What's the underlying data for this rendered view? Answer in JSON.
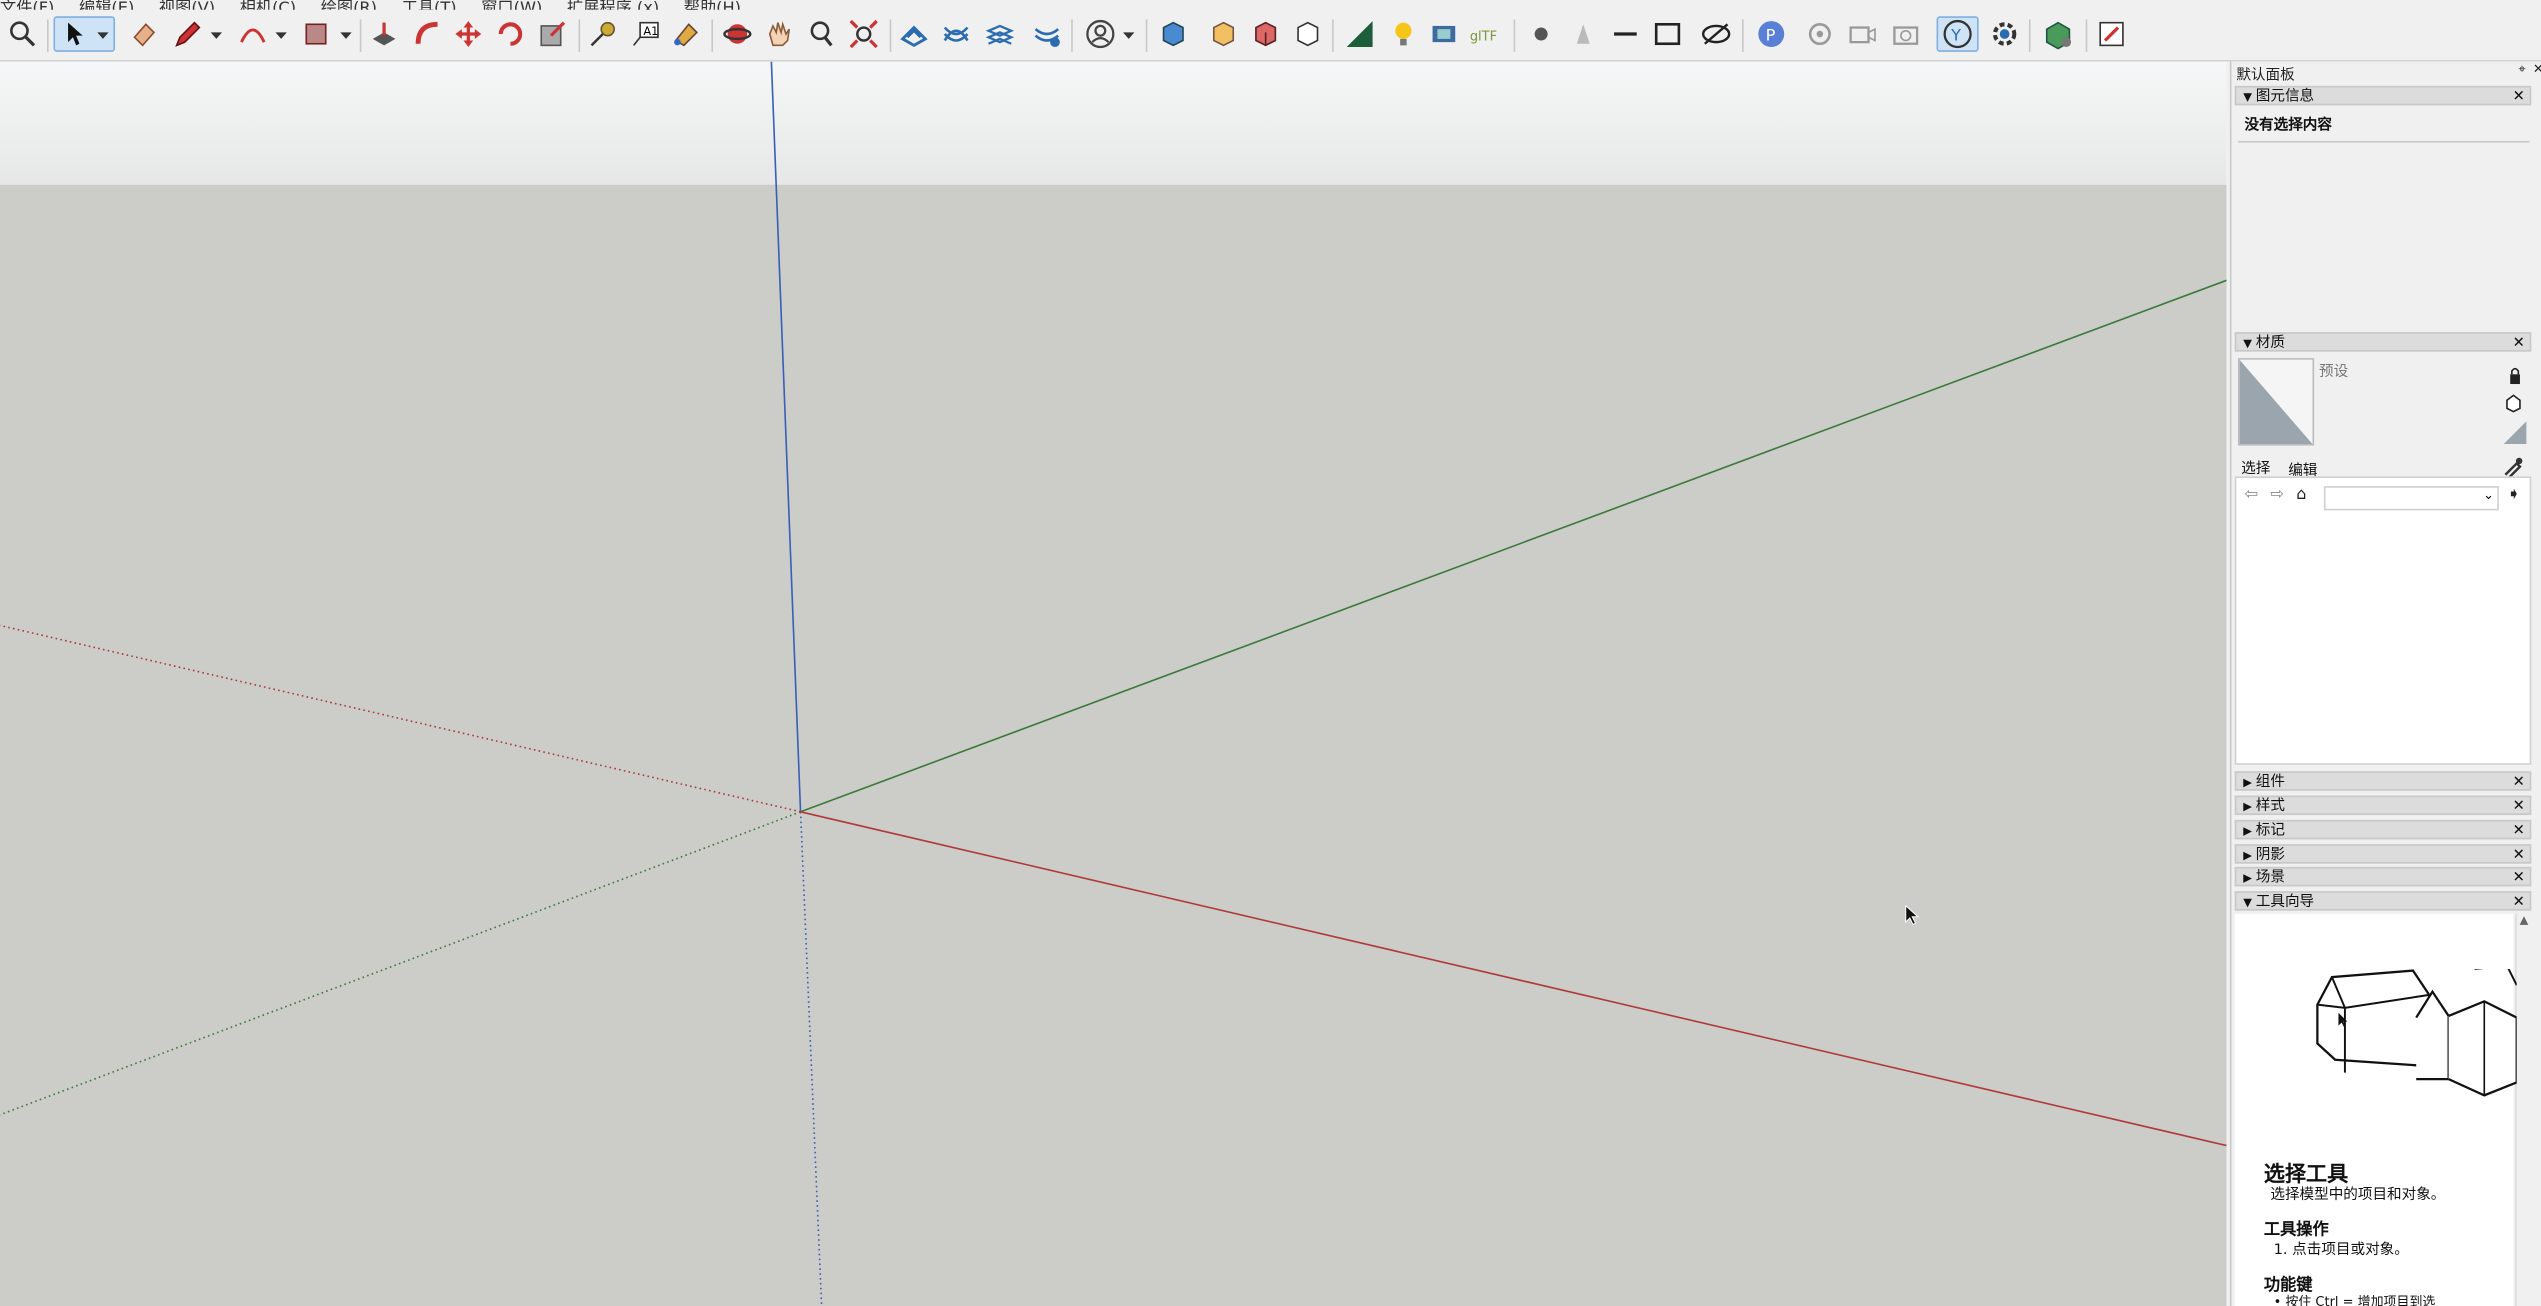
{
  "menu": [
    "文件(F)",
    "编辑(E)",
    "视图(V)",
    "相机(C)",
    "绘图(R)",
    "工具(T)",
    "窗口(W)",
    "扩展程序 (x)",
    "帮助(H)"
  ],
  "tray": {
    "title": "默认面板",
    "entity_info": {
      "label": "图元信息",
      "content": "没有选择内容"
    },
    "materials": {
      "label": "材质",
      "name_placeholder": "预设",
      "tab_select": "选择",
      "tab_edit": "编辑"
    },
    "collapsed": [
      "组件",
      "样式",
      "标记",
      "阴影",
      "场景"
    ],
    "instructor": {
      "label": "工具向导",
      "title": "选择工具",
      "subtitle": "选择模型中的项目和对象。",
      "ops_heading": "工具操作",
      "ops_step": "1. 点击项目或对象。",
      "keys_heading": "功能键",
      "keys_item": "• 按住 Ctrl = 增加项目到选"
    }
  },
  "colors": {
    "sky": "#f4f5f6",
    "ground": "#cccdc8",
    "red_axis": "#b03a3a",
    "green_axis": "#3c7a3c",
    "blue_axis": "#3a5fb8"
  },
  "icons": [
    "zoom-icon",
    "select-icon",
    "eraser-icon",
    "pencil-icon",
    "arc-icon",
    "shape-icon",
    "pushpull-icon",
    "followme-icon",
    "move-icon",
    "rotate-icon",
    "scale-icon",
    "tape-icon",
    "text-icon",
    "paint-icon",
    "orbit-icon",
    "pan-icon",
    "zoomwindow-icon",
    "zoomext-icon",
    "sandbox-icons",
    "user-icon",
    "views-icons",
    "section-icons",
    "sun-icon",
    "style-icons",
    "extension-icons"
  ]
}
